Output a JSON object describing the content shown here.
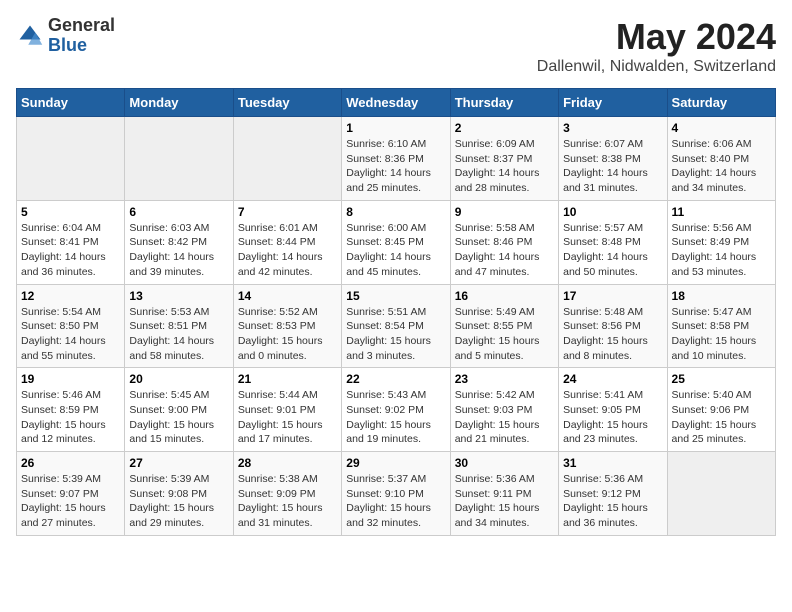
{
  "logo": {
    "general": "General",
    "blue": "Blue"
  },
  "title": "May 2024",
  "subtitle": "Dallenwil, Nidwalden, Switzerland",
  "headers": [
    "Sunday",
    "Monday",
    "Tuesday",
    "Wednesday",
    "Thursday",
    "Friday",
    "Saturday"
  ],
  "weeks": [
    [
      {
        "day": "",
        "detail": ""
      },
      {
        "day": "",
        "detail": ""
      },
      {
        "day": "",
        "detail": ""
      },
      {
        "day": "1",
        "detail": "Sunrise: 6:10 AM\nSunset: 8:36 PM\nDaylight: 14 hours\nand 25 minutes."
      },
      {
        "day": "2",
        "detail": "Sunrise: 6:09 AM\nSunset: 8:37 PM\nDaylight: 14 hours\nand 28 minutes."
      },
      {
        "day": "3",
        "detail": "Sunrise: 6:07 AM\nSunset: 8:38 PM\nDaylight: 14 hours\nand 31 minutes."
      },
      {
        "day": "4",
        "detail": "Sunrise: 6:06 AM\nSunset: 8:40 PM\nDaylight: 14 hours\nand 34 minutes."
      }
    ],
    [
      {
        "day": "5",
        "detail": "Sunrise: 6:04 AM\nSunset: 8:41 PM\nDaylight: 14 hours\nand 36 minutes."
      },
      {
        "day": "6",
        "detail": "Sunrise: 6:03 AM\nSunset: 8:42 PM\nDaylight: 14 hours\nand 39 minutes."
      },
      {
        "day": "7",
        "detail": "Sunrise: 6:01 AM\nSunset: 8:44 PM\nDaylight: 14 hours\nand 42 minutes."
      },
      {
        "day": "8",
        "detail": "Sunrise: 6:00 AM\nSunset: 8:45 PM\nDaylight: 14 hours\nand 45 minutes."
      },
      {
        "day": "9",
        "detail": "Sunrise: 5:58 AM\nSunset: 8:46 PM\nDaylight: 14 hours\nand 47 minutes."
      },
      {
        "day": "10",
        "detail": "Sunrise: 5:57 AM\nSunset: 8:48 PM\nDaylight: 14 hours\nand 50 minutes."
      },
      {
        "day": "11",
        "detail": "Sunrise: 5:56 AM\nSunset: 8:49 PM\nDaylight: 14 hours\nand 53 minutes."
      }
    ],
    [
      {
        "day": "12",
        "detail": "Sunrise: 5:54 AM\nSunset: 8:50 PM\nDaylight: 14 hours\nand 55 minutes."
      },
      {
        "day": "13",
        "detail": "Sunrise: 5:53 AM\nSunset: 8:51 PM\nDaylight: 14 hours\nand 58 minutes."
      },
      {
        "day": "14",
        "detail": "Sunrise: 5:52 AM\nSunset: 8:53 PM\nDaylight: 15 hours\nand 0 minutes."
      },
      {
        "day": "15",
        "detail": "Sunrise: 5:51 AM\nSunset: 8:54 PM\nDaylight: 15 hours\nand 3 minutes."
      },
      {
        "day": "16",
        "detail": "Sunrise: 5:49 AM\nSunset: 8:55 PM\nDaylight: 15 hours\nand 5 minutes."
      },
      {
        "day": "17",
        "detail": "Sunrise: 5:48 AM\nSunset: 8:56 PM\nDaylight: 15 hours\nand 8 minutes."
      },
      {
        "day": "18",
        "detail": "Sunrise: 5:47 AM\nSunset: 8:58 PM\nDaylight: 15 hours\nand 10 minutes."
      }
    ],
    [
      {
        "day": "19",
        "detail": "Sunrise: 5:46 AM\nSunset: 8:59 PM\nDaylight: 15 hours\nand 12 minutes."
      },
      {
        "day": "20",
        "detail": "Sunrise: 5:45 AM\nSunset: 9:00 PM\nDaylight: 15 hours\nand 15 minutes."
      },
      {
        "day": "21",
        "detail": "Sunrise: 5:44 AM\nSunset: 9:01 PM\nDaylight: 15 hours\nand 17 minutes."
      },
      {
        "day": "22",
        "detail": "Sunrise: 5:43 AM\nSunset: 9:02 PM\nDaylight: 15 hours\nand 19 minutes."
      },
      {
        "day": "23",
        "detail": "Sunrise: 5:42 AM\nSunset: 9:03 PM\nDaylight: 15 hours\nand 21 minutes."
      },
      {
        "day": "24",
        "detail": "Sunrise: 5:41 AM\nSunset: 9:05 PM\nDaylight: 15 hours\nand 23 minutes."
      },
      {
        "day": "25",
        "detail": "Sunrise: 5:40 AM\nSunset: 9:06 PM\nDaylight: 15 hours\nand 25 minutes."
      }
    ],
    [
      {
        "day": "26",
        "detail": "Sunrise: 5:39 AM\nSunset: 9:07 PM\nDaylight: 15 hours\nand 27 minutes."
      },
      {
        "day": "27",
        "detail": "Sunrise: 5:39 AM\nSunset: 9:08 PM\nDaylight: 15 hours\nand 29 minutes."
      },
      {
        "day": "28",
        "detail": "Sunrise: 5:38 AM\nSunset: 9:09 PM\nDaylight: 15 hours\nand 31 minutes."
      },
      {
        "day": "29",
        "detail": "Sunrise: 5:37 AM\nSunset: 9:10 PM\nDaylight: 15 hours\nand 32 minutes."
      },
      {
        "day": "30",
        "detail": "Sunrise: 5:36 AM\nSunset: 9:11 PM\nDaylight: 15 hours\nand 34 minutes."
      },
      {
        "day": "31",
        "detail": "Sunrise: 5:36 AM\nSunset: 9:12 PM\nDaylight: 15 hours\nand 36 minutes."
      },
      {
        "day": "",
        "detail": ""
      }
    ]
  ]
}
